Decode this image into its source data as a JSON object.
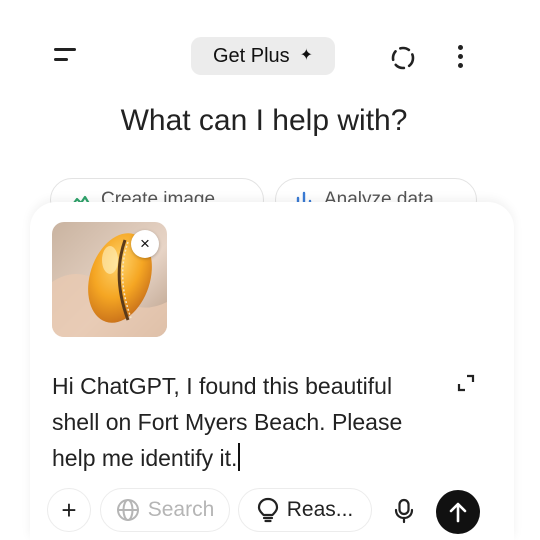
{
  "header": {
    "get_plus_label": "Get Plus",
    "get_plus_icon": "✦"
  },
  "headline": "What can I help with?",
  "suggestions": [
    {
      "label": "Create image",
      "icon": "image-sparkle-icon"
    },
    {
      "label": "Analyze data",
      "icon": "bar-chart-icon"
    }
  ],
  "composer": {
    "attachment": {
      "type": "image",
      "subject": "orange cowrie shell"
    },
    "remove_icon": "×",
    "message": "Hi ChatGPT, I found this beautiful\nshell on Fort Myers Beach. Please\nhelp me identify it."
  },
  "toolbar": {
    "plus_label": "+",
    "search_label": "Search",
    "reason_label": "Reas..."
  },
  "colors": {
    "send_button": "#111111",
    "chip_border": "#e3e3e3",
    "get_plus_bg": "#ececec"
  }
}
